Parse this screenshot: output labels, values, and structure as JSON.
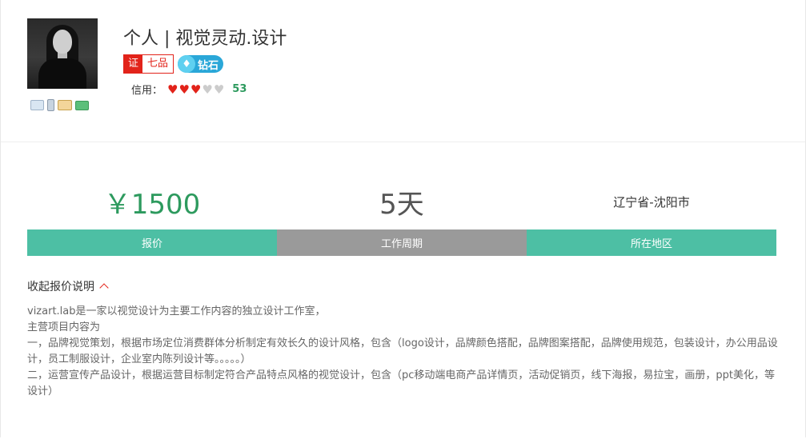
{
  "shop": {
    "title": "个人 | 视觉灵动.设计",
    "cert_label": "证",
    "cert_grade": "七品",
    "level_gem": "♦",
    "level_text": "钻石",
    "credit_label": "信用：",
    "credit_hearts_filled": 3,
    "credit_hearts_total": 5,
    "credit_score": "53"
  },
  "verify_icons": [
    "id-card-icon",
    "phone-icon",
    "email-icon",
    "bank-card-icon"
  ],
  "stats": {
    "price": "￥1500",
    "period": "5天",
    "region": "辽宁省-沈阳市"
  },
  "labels": {
    "price": "报价",
    "period": "工作周期",
    "region": "所在地区"
  },
  "toggle": {
    "label": "收起报价说明"
  },
  "description": [
    "vizart.lab是一家以视觉设计为主要工作内容的独立设计工作室，",
    "主营项目内容为",
    "一，品牌视觉策划，根据市场定位消费群体分析制定有效长久的设计风格，包含（logo设计，品牌颜色搭配，品牌图案搭配，品牌使用规范，包装设计，办公用品设计，员工制服设计，企业室内陈列设计等。。。。。）",
    "二，运营宣传产品设计，根据运营目标制定符合产品特点风格的视觉设计，包含（pc移动端电商产品详情页，活动促销页，线下海报，易拉宝，画册，ppt美化，等设计）"
  ],
  "colors": {
    "accent_green": "#4dbfa4",
    "price_green": "#2d9a5e",
    "cert_red": "#e2231a",
    "diamond_blue": "#2aa7d8",
    "gray_tab": "#9a9a9a"
  }
}
